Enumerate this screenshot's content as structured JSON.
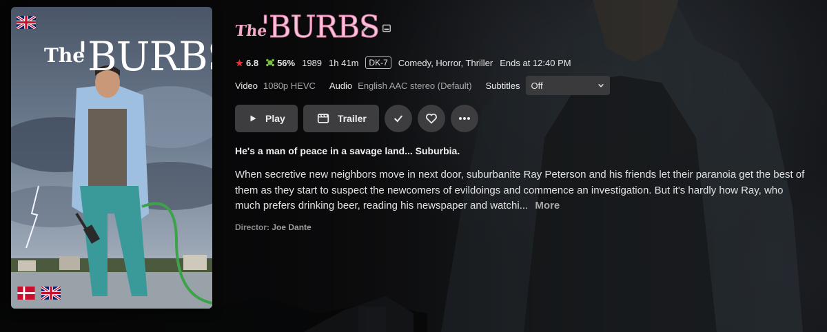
{
  "title": "The 'BURBS",
  "logo": {
    "the": "The",
    "burbs": "'BURBS"
  },
  "poster": {
    "title_the": "The",
    "title_burbs": "'BURBS",
    "flags": [
      "uk-flag-icon",
      "denmark-flag-icon",
      "uk-flag-icon"
    ]
  },
  "title_icons": [
    "edit-icon",
    "image-icon"
  ],
  "meta": {
    "community_rating": "6.8",
    "critic_rating": "56%",
    "year": "1989",
    "runtime": "1h 41m",
    "certification": "DK-7",
    "genres": "Comedy, Horror, Thriller",
    "ends_at": "Ends at 12:40 PM"
  },
  "streams": {
    "video_label": "Video",
    "video_value": "1080p HEVC",
    "audio_label": "Audio",
    "audio_value": "English AAC stereo (Default)",
    "subtitles_label": "Subtitles",
    "subtitles_value": "Off"
  },
  "actions": {
    "play": "Play",
    "trailer": "Trailer"
  },
  "tagline": "He's a man of peace in a savage land... Suburbia.",
  "overview": "When secretive new neighbors move in next door, suburbanite Ray Peterson and his friends let their paranoia get the best of them as they start to suspect the newcomers of evildoings and commence an investigation. But it's hardly how Ray, who much prefers drinking beer, reading his newspaper and watchi...",
  "overview_more": "More",
  "director": {
    "label": "Director:",
    "name": "Joe Dante"
  },
  "colors": {
    "accent_star": "#e0303a",
    "critic": "#7ac043",
    "logo_pink": "#f8c4dc"
  }
}
